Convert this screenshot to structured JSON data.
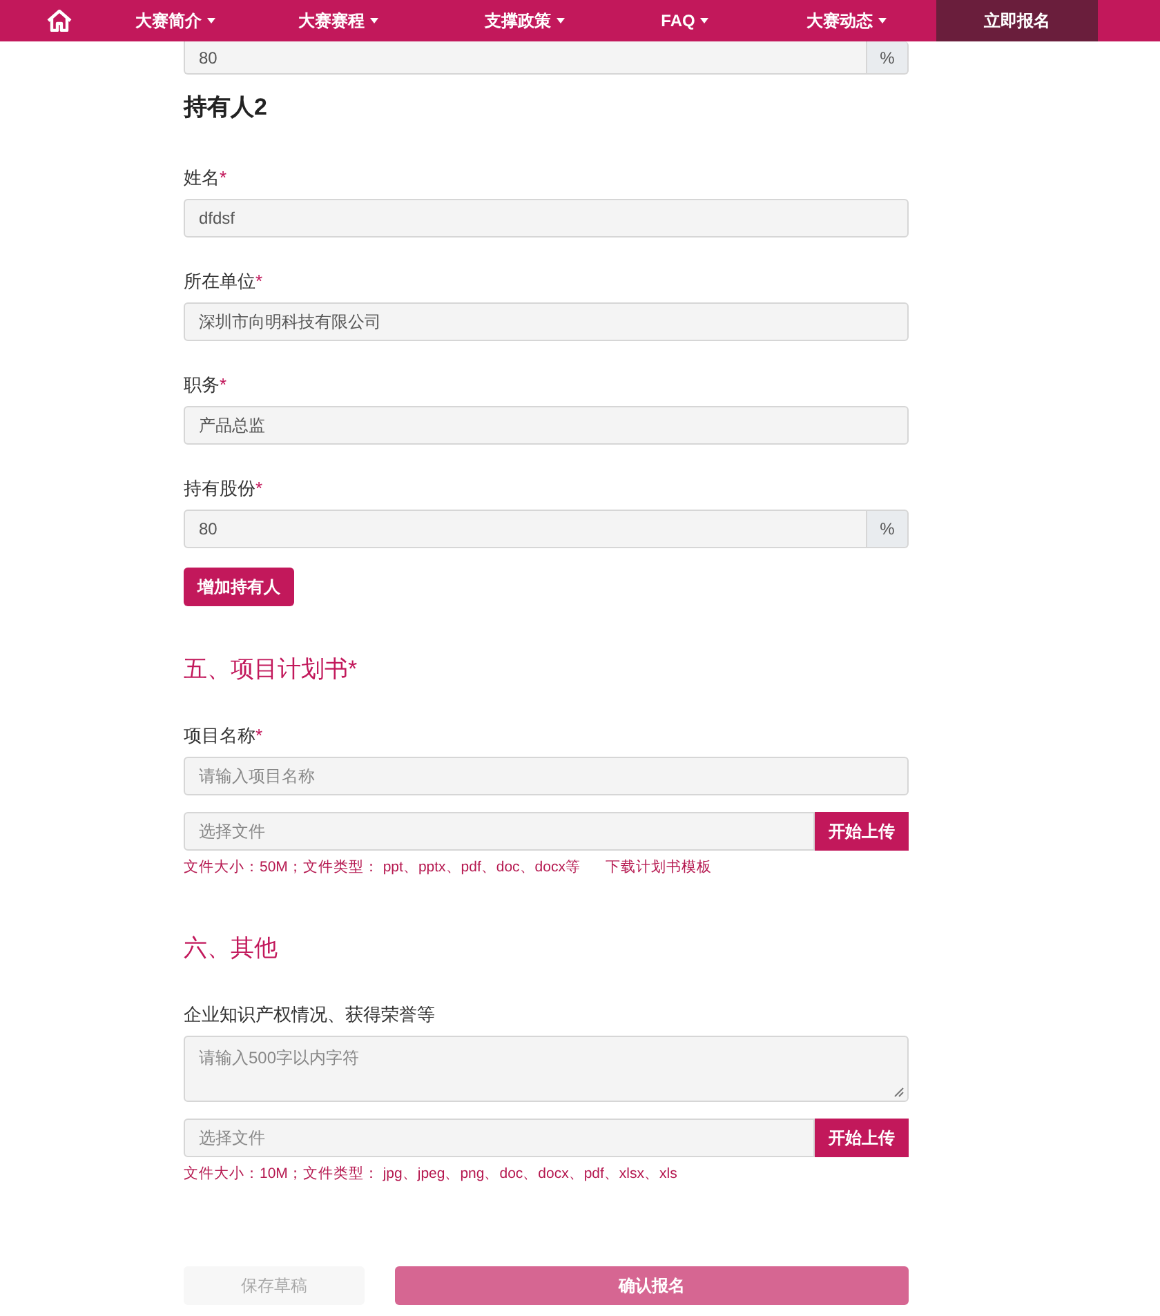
{
  "nav": {
    "items": [
      {
        "label": "大赛简介",
        "dropdown": true
      },
      {
        "label": "大赛赛程",
        "dropdown": true
      },
      {
        "label": "支撑政策",
        "dropdown": true
      },
      {
        "label": "FAQ",
        "dropdown": true
      },
      {
        "label": "大赛动态",
        "dropdown": true
      }
    ],
    "register": "立即报名"
  },
  "top_field": {
    "value": "80",
    "suffix": "%"
  },
  "holder": {
    "title": "持有人2",
    "fields": [
      {
        "kind": "text",
        "label": "姓名",
        "asterisk": "*",
        "value": "dfdsf"
      },
      {
        "kind": "text",
        "label": "所在单位",
        "asterisk": "*",
        "value": "深圳市向明科技有限公司"
      },
      {
        "kind": "text",
        "label": "职务",
        "asterisk": "*",
        "value": "产品总监"
      },
      {
        "kind": "suffix",
        "label": "持有股份",
        "asterisk": "*",
        "value": "80",
        "suffix": "%"
      }
    ],
    "add_button": "增加持有人"
  },
  "sections": [
    {
      "title": "五、项目计划书",
      "asterisk": "*",
      "fields": [
        {
          "kind": "text",
          "label": "项目名称",
          "asterisk": "*",
          "placeholder": "请输入项目名称"
        },
        {
          "kind": "file",
          "placeholder": "选择文件",
          "button": "开始上传",
          "hint": "文件大小：50M；文件类型： ppt、pptx、pdf、doc、docx等",
          "link": "下载计划书模板"
        }
      ]
    },
    {
      "title": "六、其他",
      "fields": [
        {
          "kind": "textarea",
          "label": "企业知识产权情况、获得荣誉等",
          "placeholder": "请输入500字以内字符"
        },
        {
          "kind": "file",
          "placeholder": "选择文件",
          "button": "开始上传",
          "hint": "文件大小：10M；文件类型： jpg、jpeg、png、doc、docx、pdf、xlsx、xls"
        }
      ]
    }
  ],
  "actions": [
    {
      "label": "保存草稿",
      "kind": "secondary",
      "disabled": true
    },
    {
      "label": "确认报名",
      "kind": "primary",
      "disabled": true
    }
  ]
}
